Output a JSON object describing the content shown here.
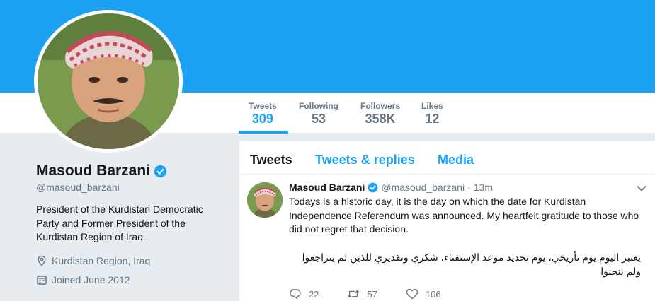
{
  "profile": {
    "name": "Masoud Barzani",
    "handle": "@masoud_barzani",
    "bio": "President of the Kurdistan Democratic Party and Former President of the Kurdistan Region of Iraq",
    "location": "Kurdistan Region, Iraq",
    "joined": "Joined June 2012"
  },
  "stats": [
    {
      "label": "Tweets",
      "value": "309"
    },
    {
      "label": "Following",
      "value": "53"
    },
    {
      "label": "Followers",
      "value": "358K"
    },
    {
      "label": "Likes",
      "value": "12"
    }
  ],
  "tabs": [
    "Tweets",
    "Tweets & replies",
    "Media"
  ],
  "tweet": {
    "name": "Masoud Barzani",
    "handle": "@masoud_barzani",
    "dot": "·",
    "time": "13m",
    "text": "Todays is a historic day, it is the day on which the date for Kurdistan Independence Referendum was announced. My heartfelt gratitude to those who did not regret that decision.",
    "text_arabic": "يعتبر اليوم يوم تأريخي، يوم تحديد موعد الإستفتاء، شكري وتقديري للذين لم يتراجعوا ولم ينحنوا",
    "replies": "22",
    "retweets": "57",
    "likes": "106"
  },
  "colors": {
    "accent": "#1da1f2",
    "verified": "#1da1f2",
    "muted": "#657786",
    "text": "#14171a",
    "background": "#e6ecf0"
  },
  "icons": [
    "verified-badge-icon",
    "location-pin-icon",
    "calendar-icon",
    "chevron-down-icon",
    "reply-icon",
    "retweet-icon",
    "heart-icon"
  ]
}
